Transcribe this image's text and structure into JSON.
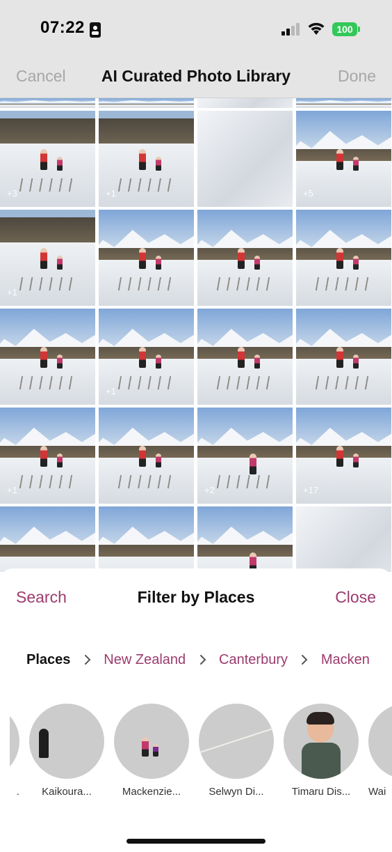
{
  "status_bar": {
    "time": "07:22",
    "battery": "100",
    "battery_color": "#34c759"
  },
  "nav": {
    "cancel": "Cancel",
    "title": "AI Curated Photo Library",
    "done": "Done"
  },
  "grid": {
    "photos": [
      {
        "variant": "v-tall",
        "badge": ""
      },
      {
        "variant": "v-tall",
        "badge": ""
      },
      {
        "variant": "v-snow",
        "badge": ""
      },
      {
        "variant": "v-tall",
        "badge": ""
      },
      {
        "variant": "v-rock",
        "badge": "+3",
        "people": "2",
        "writing": true
      },
      {
        "variant": "v-rock",
        "badge": "+1",
        "people": "2",
        "writing": true
      },
      {
        "variant": "v-snow",
        "badge": ""
      },
      {
        "variant": "",
        "badge": "+5",
        "people": "2"
      },
      {
        "variant": "v-rock",
        "badge": "+1",
        "people": "2",
        "writing": true
      },
      {
        "variant": "",
        "badge": "",
        "people": "2",
        "writing": true
      },
      {
        "variant": "",
        "badge": "",
        "people": "2",
        "writing": true
      },
      {
        "variant": "",
        "badge": "",
        "people": "2",
        "writing": true
      },
      {
        "variant": "",
        "badge": "",
        "people": "2",
        "writing": true
      },
      {
        "variant": "",
        "badge": "+1",
        "people": "2",
        "writing": true
      },
      {
        "variant": "",
        "badge": "",
        "people": "2",
        "writing": true
      },
      {
        "variant": "",
        "badge": "",
        "people": "2",
        "writing": true
      },
      {
        "variant": "",
        "badge": "+1",
        "people": "2",
        "writing": true
      },
      {
        "variant": "",
        "badge": "",
        "people": "2",
        "writing": true
      },
      {
        "variant": "",
        "badge": "+2",
        "people": "1",
        "writing": true
      },
      {
        "variant": "",
        "badge": "+17",
        "people": "2"
      },
      {
        "variant": "",
        "badge": ""
      },
      {
        "variant": "",
        "badge": ""
      },
      {
        "variant": "",
        "badge": "",
        "people": "1"
      },
      {
        "variant": "v-snow",
        "badge": ""
      }
    ]
  },
  "sheet": {
    "search": "Search",
    "title": "Filter by Places",
    "close": "Close",
    "breadcrumb": {
      "root": "Places",
      "items": [
        "New Zealand",
        "Canterbury",
        "Macken"
      ]
    },
    "places": [
      {
        "label": ".",
        "thumb": "thumb-blue"
      },
      {
        "label": "Kaikoura...",
        "thumb": "thumb-sunset"
      },
      {
        "label": "Mackenzie...",
        "thumb": "thumb-mount"
      },
      {
        "label": "Selwyn Di...",
        "thumb": "thumb-floor"
      },
      {
        "label": "Timaru Dis...",
        "thumb": "thumb-kid"
      },
      {
        "label": "Wai",
        "thumb": "thumb-blue"
      }
    ],
    "accent_color": "#9b3b6e"
  }
}
